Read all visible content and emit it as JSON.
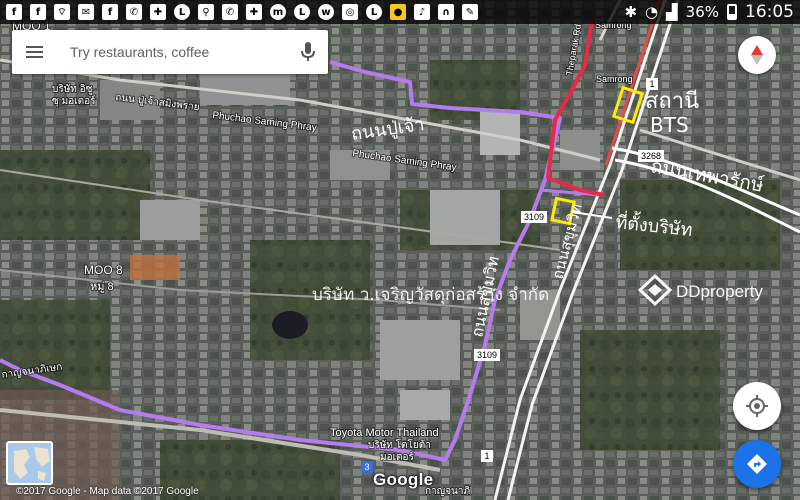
{
  "status_bar": {
    "left_icons": [
      "f",
      "f",
      "wifi",
      "mail",
      "f",
      "phone",
      "wrench",
      "line",
      "pin",
      "phone-x",
      "tool",
      "messenger",
      "line",
      "whatsapp",
      "instagram",
      "line",
      "yellow-app",
      "bell",
      "headset",
      "stylus"
    ],
    "battery": "36%",
    "time": "16:05"
  },
  "search": {
    "placeholder": "Try restaurants, coffee"
  },
  "map_labels": {
    "moo1": "MOO 1",
    "company_top_1": "บริษัท อิซู",
    "company_top_2": "ซุ มอเตอร์",
    "road_thai": "ถนน ปู่เจ้าสมิงพราย",
    "road_en_1": "Phuchao Saming Phray",
    "road_en_2": "Phuchao Saming Phray",
    "road_right": "Theparak Rd",
    "samrong_top": "Samrong",
    "samrong": "Samrong",
    "moo8_en": "MOO 8",
    "moo8_th": "หมู่ 8",
    "toyota_en": "Toyota Motor Thailand",
    "toyota_th_1": "บริษัท โตโยต้า",
    "toyota_th_2": "มอเตอร์",
    "route_3109_a": "3109",
    "route_3109_b": "3109",
    "route_3268": "3268",
    "route_1": "1",
    "route_1_b": "1",
    "route_3": "3",
    "road_bottom_left": "กาญจนาภิเษก",
    "road_bottom": "กาญจนาภิ"
  },
  "handwriting": {
    "puchao": "ถนนปู่เจ้า",
    "station": "สถานี",
    "bts": "BTS",
    "theparak": "ถนนเทพารักษ์",
    "office": "ที่ตั้งบริษัท",
    "left_vertical": "ถนนสุขุมวิท",
    "suk": "ถนนสุขุมวิท"
  },
  "watermark": {
    "company": "บริษัท  ว.เจริญวัสดุก่อสร้าง  จำกัด",
    "brand": "DDproperty"
  },
  "attribution": "©2017 Google - Map data ©2017 Google",
  "logo": "Google",
  "colors": {
    "route_purple": "#b57cf0",
    "route_red": "#e52a4a",
    "marker_yellow": "#ffea00",
    "directions_blue": "#1a73e8",
    "compass_red": "#e53935"
  },
  "icons": {
    "menu": "hamburger-icon",
    "mic": "mic-icon",
    "compass": "compass-icon",
    "locate": "my-location-icon",
    "directions": "directions-icon"
  }
}
